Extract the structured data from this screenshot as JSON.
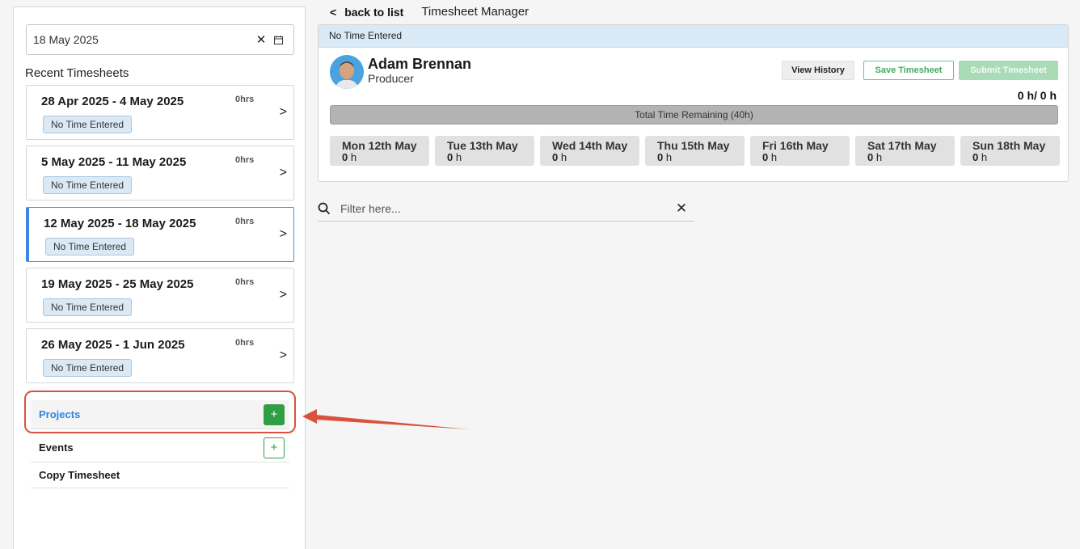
{
  "sidebar": {
    "date_value": "18 May 2025",
    "clear_glyph": "✕",
    "recent_title": "Recent Timesheets",
    "timesheets": [
      {
        "range": "28 Apr 2025 - 4 May 2025",
        "hours": "0hrs",
        "status": "No Time Entered"
      },
      {
        "range": "5 May 2025 - 11 May 2025",
        "hours": "0hrs",
        "status": "No Time Entered"
      },
      {
        "range": "12 May 2025 - 18 May 2025",
        "hours": "0hrs",
        "status": "No Time Entered",
        "selected": true
      },
      {
        "range": "19 May 2025 - 25 May 2025",
        "hours": "0hrs",
        "status": "No Time Entered"
      },
      {
        "range": "26 May 2025 - 1 Jun 2025",
        "hours": "0hrs",
        "status": "No Time Entered"
      }
    ],
    "menu": {
      "projects": "Projects",
      "events": "Events",
      "copy": "Copy Timesheet",
      "plus": "+"
    }
  },
  "header": {
    "back_label": "back to list",
    "title": "Timesheet Manager"
  },
  "panel": {
    "status": "No Time Entered",
    "user": {
      "name": "Adam Brennan",
      "role": "Producer"
    },
    "buttons": {
      "history": "View History",
      "save": "Save Timesheet",
      "submit": "Submit Timesheet"
    },
    "hours_total": "0 h/ 0 h",
    "progress_label": "Total Time Remaining (40h)",
    "progress_fraction": 0,
    "days": [
      {
        "name": "Mon 12th May",
        "hours": "0",
        "unit": "h"
      },
      {
        "name": "Tue 13th May",
        "hours": "0",
        "unit": "h"
      },
      {
        "name": "Wed 14th May",
        "hours": "0",
        "unit": "h"
      },
      {
        "name": "Thu 15th May",
        "hours": "0",
        "unit": "h"
      },
      {
        "name": "Fri 16th May",
        "hours": "0",
        "unit": "h"
      },
      {
        "name": "Sat 17th May",
        "hours": "0",
        "unit": "h"
      },
      {
        "name": "Sun 18th May",
        "hours": "0",
        "unit": "h"
      }
    ]
  },
  "filter": {
    "placeholder": "Filter here...",
    "value": "",
    "clear_glyph": "✕"
  },
  "colors": {
    "accent_blue": "#3a86e0",
    "green": "#2f9e44",
    "annotation_red": "#d9533c",
    "status_bg": "#d9e9f5"
  }
}
